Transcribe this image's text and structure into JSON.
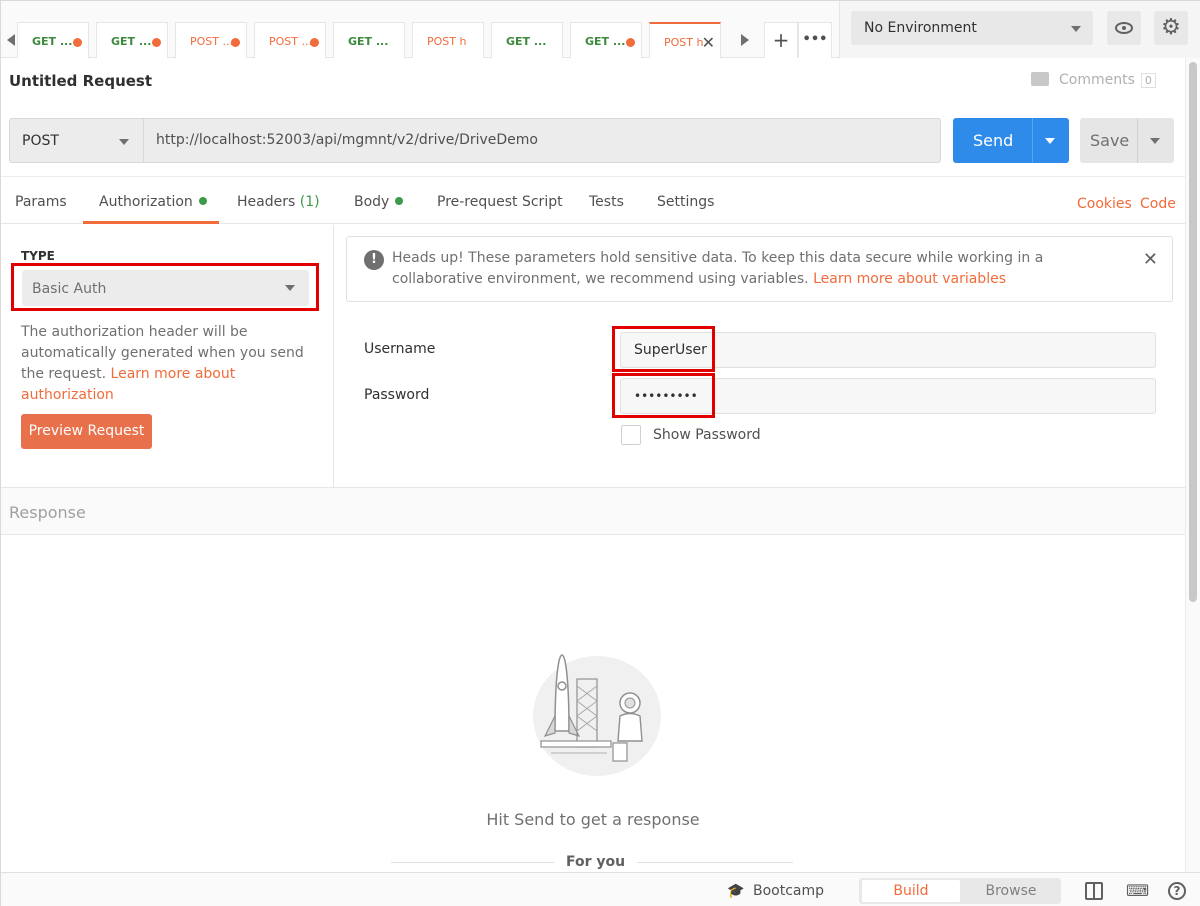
{
  "tabs": [
    {
      "method": "GET",
      "label": "GET ...",
      "unsaved": true
    },
    {
      "method": "GET",
      "label": "GET ...",
      "unsaved": true
    },
    {
      "method": "POST",
      "label": "POST ...",
      "unsaved": true
    },
    {
      "method": "POST",
      "label": "POST ...",
      "unsaved": true
    },
    {
      "method": "GET",
      "label": "GET ...",
      "unsaved": false
    },
    {
      "method": "POST",
      "label": "POST h",
      "unsaved": false
    },
    {
      "method": "GET",
      "label": "GET ...",
      "unsaved": false
    },
    {
      "method": "GET",
      "label": "GET ...",
      "unsaved": true
    },
    {
      "method": "POST",
      "label": "POST h",
      "active": true
    }
  ],
  "tab_actions": {
    "new": "+",
    "more": "•••"
  },
  "environment": {
    "selected": "No Environment"
  },
  "request": {
    "title": "Untitled Request",
    "comments_label": "Comments",
    "comments_count": "0",
    "method": "POST",
    "url": "http://localhost:52003/api/mgmnt/v2/drive/DriveDemo",
    "send_label": "Send",
    "save_label": "Save"
  },
  "request_tabs": {
    "params": "Params",
    "authorization": "Authorization",
    "headers": "Headers",
    "headers_count": "(1)",
    "body": "Body",
    "prerequest": "Pre-request Script",
    "tests": "Tests",
    "settings": "Settings",
    "cookies": "Cookies",
    "code": "Code"
  },
  "auth": {
    "type_label": "TYPE",
    "type_value": "Basic Auth",
    "description": "The authorization header will be automatically generated when you send the request. ",
    "description_link": "Learn more about authorization",
    "preview_button": "Preview Request",
    "notice_text": "Heads up! These parameters hold sensitive data. To keep this data secure while working in a collaborative environment, we recommend using variables. ",
    "notice_link": "Learn more about variables",
    "username_label": "Username",
    "username_value": "SuperUser",
    "password_label": "Password",
    "password_value": "•••••••••",
    "show_password_label": "Show Password"
  },
  "response": {
    "header": "Response",
    "empty_message": "Hit Send to get a response",
    "for_you": "For you"
  },
  "statusbar": {
    "bootcamp": "Bootcamp",
    "build": "Build",
    "browse": "Browse"
  },
  "colors": {
    "accent": "#f26b3a",
    "send": "#2f8bea",
    "get": "#3c8a3c",
    "highlight": "#e00000"
  }
}
